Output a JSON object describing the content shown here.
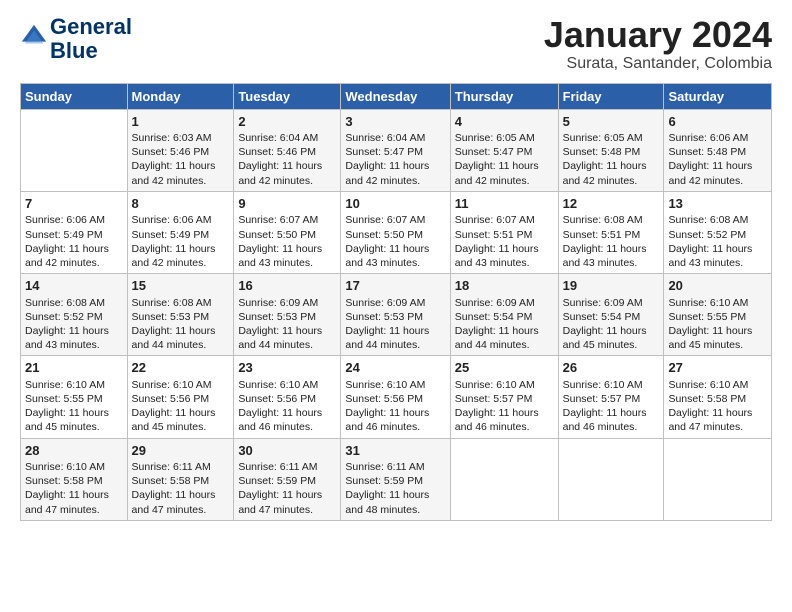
{
  "header": {
    "logo_line1": "General",
    "logo_line2": "Blue",
    "month": "January 2024",
    "location": "Surata, Santander, Colombia"
  },
  "weekdays": [
    "Sunday",
    "Monday",
    "Tuesday",
    "Wednesday",
    "Thursday",
    "Friday",
    "Saturday"
  ],
  "weeks": [
    [
      {
        "day": "",
        "text": ""
      },
      {
        "day": "1",
        "text": "Sunrise: 6:03 AM\nSunset: 5:46 PM\nDaylight: 11 hours\nand 42 minutes."
      },
      {
        "day": "2",
        "text": "Sunrise: 6:04 AM\nSunset: 5:46 PM\nDaylight: 11 hours\nand 42 minutes."
      },
      {
        "day": "3",
        "text": "Sunrise: 6:04 AM\nSunset: 5:47 PM\nDaylight: 11 hours\nand 42 minutes."
      },
      {
        "day": "4",
        "text": "Sunrise: 6:05 AM\nSunset: 5:47 PM\nDaylight: 11 hours\nand 42 minutes."
      },
      {
        "day": "5",
        "text": "Sunrise: 6:05 AM\nSunset: 5:48 PM\nDaylight: 11 hours\nand 42 minutes."
      },
      {
        "day": "6",
        "text": "Sunrise: 6:06 AM\nSunset: 5:48 PM\nDaylight: 11 hours\nand 42 minutes."
      }
    ],
    [
      {
        "day": "7",
        "text": "Sunrise: 6:06 AM\nSunset: 5:49 PM\nDaylight: 11 hours\nand 42 minutes."
      },
      {
        "day": "8",
        "text": "Sunrise: 6:06 AM\nSunset: 5:49 PM\nDaylight: 11 hours\nand 42 minutes."
      },
      {
        "day": "9",
        "text": "Sunrise: 6:07 AM\nSunset: 5:50 PM\nDaylight: 11 hours\nand 43 minutes."
      },
      {
        "day": "10",
        "text": "Sunrise: 6:07 AM\nSunset: 5:50 PM\nDaylight: 11 hours\nand 43 minutes."
      },
      {
        "day": "11",
        "text": "Sunrise: 6:07 AM\nSunset: 5:51 PM\nDaylight: 11 hours\nand 43 minutes."
      },
      {
        "day": "12",
        "text": "Sunrise: 6:08 AM\nSunset: 5:51 PM\nDaylight: 11 hours\nand 43 minutes."
      },
      {
        "day": "13",
        "text": "Sunrise: 6:08 AM\nSunset: 5:52 PM\nDaylight: 11 hours\nand 43 minutes."
      }
    ],
    [
      {
        "day": "14",
        "text": "Sunrise: 6:08 AM\nSunset: 5:52 PM\nDaylight: 11 hours\nand 43 minutes."
      },
      {
        "day": "15",
        "text": "Sunrise: 6:08 AM\nSunset: 5:53 PM\nDaylight: 11 hours\nand 44 minutes."
      },
      {
        "day": "16",
        "text": "Sunrise: 6:09 AM\nSunset: 5:53 PM\nDaylight: 11 hours\nand 44 minutes."
      },
      {
        "day": "17",
        "text": "Sunrise: 6:09 AM\nSunset: 5:53 PM\nDaylight: 11 hours\nand 44 minutes."
      },
      {
        "day": "18",
        "text": "Sunrise: 6:09 AM\nSunset: 5:54 PM\nDaylight: 11 hours\nand 44 minutes."
      },
      {
        "day": "19",
        "text": "Sunrise: 6:09 AM\nSunset: 5:54 PM\nDaylight: 11 hours\nand 45 minutes."
      },
      {
        "day": "20",
        "text": "Sunrise: 6:10 AM\nSunset: 5:55 PM\nDaylight: 11 hours\nand 45 minutes."
      }
    ],
    [
      {
        "day": "21",
        "text": "Sunrise: 6:10 AM\nSunset: 5:55 PM\nDaylight: 11 hours\nand 45 minutes."
      },
      {
        "day": "22",
        "text": "Sunrise: 6:10 AM\nSunset: 5:56 PM\nDaylight: 11 hours\nand 45 minutes."
      },
      {
        "day": "23",
        "text": "Sunrise: 6:10 AM\nSunset: 5:56 PM\nDaylight: 11 hours\nand 46 minutes."
      },
      {
        "day": "24",
        "text": "Sunrise: 6:10 AM\nSunset: 5:56 PM\nDaylight: 11 hours\nand 46 minutes."
      },
      {
        "day": "25",
        "text": "Sunrise: 6:10 AM\nSunset: 5:57 PM\nDaylight: 11 hours\nand 46 minutes."
      },
      {
        "day": "26",
        "text": "Sunrise: 6:10 AM\nSunset: 5:57 PM\nDaylight: 11 hours\nand 46 minutes."
      },
      {
        "day": "27",
        "text": "Sunrise: 6:10 AM\nSunset: 5:58 PM\nDaylight: 11 hours\nand 47 minutes."
      }
    ],
    [
      {
        "day": "28",
        "text": "Sunrise: 6:10 AM\nSunset: 5:58 PM\nDaylight: 11 hours\nand 47 minutes."
      },
      {
        "day": "29",
        "text": "Sunrise: 6:11 AM\nSunset: 5:58 PM\nDaylight: 11 hours\nand 47 minutes."
      },
      {
        "day": "30",
        "text": "Sunrise: 6:11 AM\nSunset: 5:59 PM\nDaylight: 11 hours\nand 47 minutes."
      },
      {
        "day": "31",
        "text": "Sunrise: 6:11 AM\nSunset: 5:59 PM\nDaylight: 11 hours\nand 48 minutes."
      },
      {
        "day": "",
        "text": ""
      },
      {
        "day": "",
        "text": ""
      },
      {
        "day": "",
        "text": ""
      }
    ]
  ]
}
